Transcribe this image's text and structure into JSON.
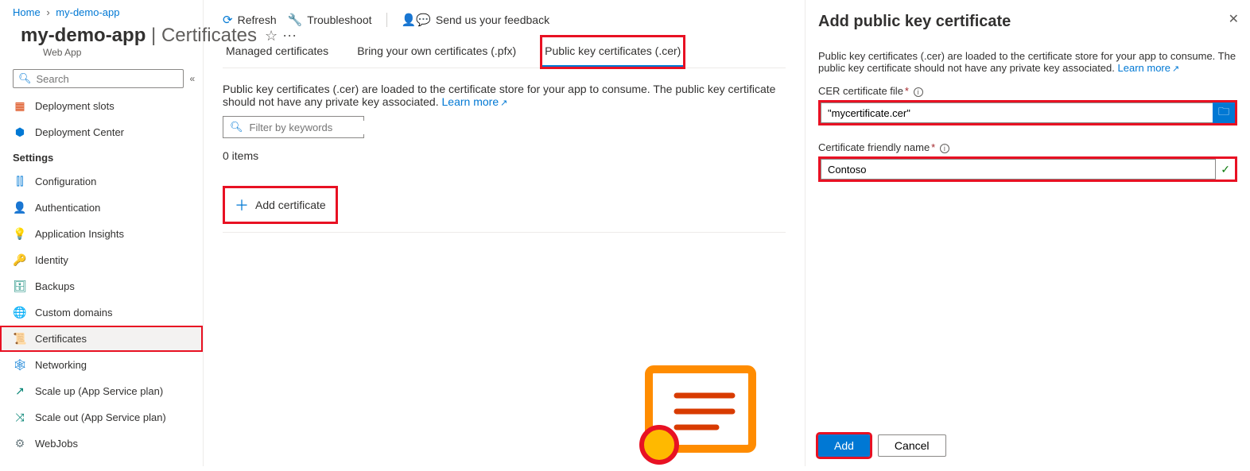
{
  "breadcrumb": {
    "home": "Home",
    "resource": "my-demo-app"
  },
  "header": {
    "title_main": "my-demo-app",
    "title_sep": " | ",
    "title_page": "Certificates",
    "subtitle": "Web App"
  },
  "search": {
    "placeholder": "Search"
  },
  "sidebar": {
    "items_top": [
      {
        "label": "Deployment slots"
      },
      {
        "label": "Deployment Center"
      }
    ],
    "heading": "Settings",
    "items": [
      {
        "label": "Configuration"
      },
      {
        "label": "Authentication"
      },
      {
        "label": "Application Insights"
      },
      {
        "label": "Identity"
      },
      {
        "label": "Backups"
      },
      {
        "label": "Custom domains"
      },
      {
        "label": "Certificates"
      },
      {
        "label": "Networking"
      },
      {
        "label": "Scale up (App Service plan)"
      },
      {
        "label": "Scale out (App Service plan)"
      },
      {
        "label": "WebJobs"
      }
    ]
  },
  "toolbar": {
    "refresh": "Refresh",
    "troubleshoot": "Troubleshoot",
    "feedback": "Send us your feedback"
  },
  "tabs": {
    "managed": "Managed certificates",
    "byoc": "Bring your own certificates (.pfx)",
    "pubkey": "Public key certificates (.cer)"
  },
  "main": {
    "description": "Public key certificates (.cer) are loaded to the certificate store for your app to consume. The public key certificate should not have any private key associated. ",
    "learn_more": "Learn more",
    "filter_placeholder": "Filter by keywords",
    "items_count": "0 items",
    "add_certificate": "Add certificate"
  },
  "panel": {
    "title": "Add public key certificate",
    "intro": "Public key certificates (.cer) are loaded to the certificate store for your app to consume. The public key certificate should not have any private key associated. ",
    "learn_more": "Learn more",
    "file_label": "CER certificate file",
    "file_value": "\"mycertificate.cer\"",
    "name_label": "Certificate friendly name",
    "name_value": "Contoso",
    "add_btn": "Add",
    "cancel_btn": "Cancel"
  }
}
